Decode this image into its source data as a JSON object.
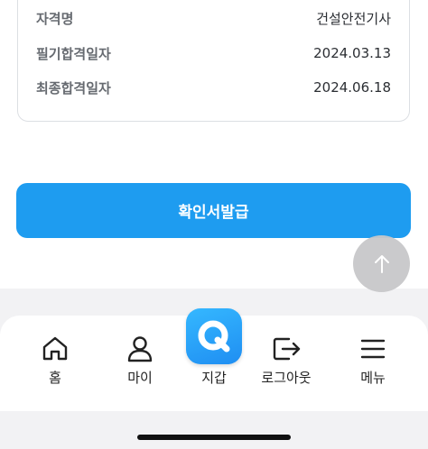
{
  "info": {
    "rows": [
      {
        "label": "자격명",
        "value": "건설안전기사"
      },
      {
        "label": "필기합격일자",
        "value": "2024.03.13"
      },
      {
        "label": "최종합격일자",
        "value": "2024.06.18"
      }
    ]
  },
  "actions": {
    "issue_button": "확인서발급"
  },
  "icons": {
    "scroll_top": "arrow-up-icon",
    "home": "home-icon",
    "my": "person-icon",
    "wallet": "wallet-q-icon",
    "logout": "logout-icon",
    "menu": "hamburger-icon"
  },
  "nav": {
    "home": "홈",
    "my": "마이",
    "wallet": "지갑",
    "logout": "로그아웃",
    "menu": "메뉴"
  },
  "colors": {
    "accent": "#1e9cf0",
    "background_band": "#f2f2f4"
  }
}
